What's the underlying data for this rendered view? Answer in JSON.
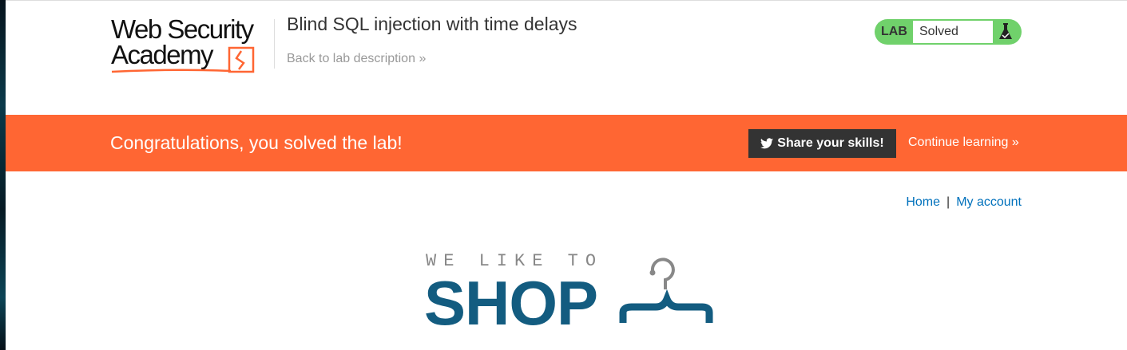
{
  "header": {
    "logo_text": [
      "Web Security",
      "Academy"
    ],
    "title": "Blind SQL injection with time delays",
    "back_link": "Back to lab description",
    "lab_badge": {
      "label": "LAB",
      "status": "Solved",
      "color": "#70d16b",
      "icon": "flask-check-icon"
    }
  },
  "banner": {
    "message": "Congratulations, you solved the lab!",
    "share_button": "Share your skills!",
    "continue_link": "Continue learning",
    "color": "#ff6633"
  },
  "nav": {
    "home": "Home",
    "separator": "|",
    "account": "My account"
  },
  "shop_logo": {
    "tagline": "WE LIKE TO",
    "name": "SHOP",
    "color": "#135c80"
  }
}
